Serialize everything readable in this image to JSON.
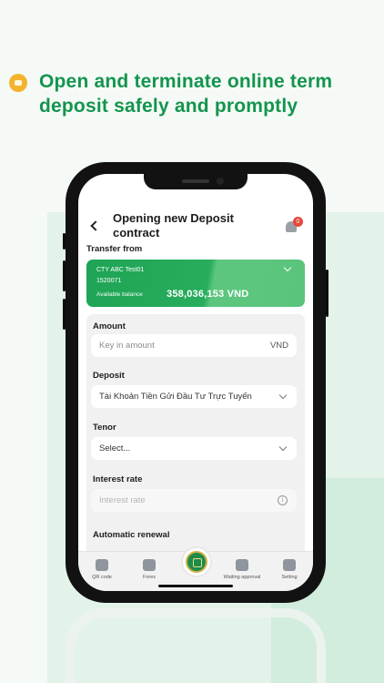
{
  "headline": "Open and terminate online term deposit safely and promptly",
  "screen": {
    "title": "Opening new Deposit contract",
    "notification_count": "0",
    "transfer_from_label": "Transfer from",
    "account": {
      "name": "CTY ABC Test01",
      "number": "1520071",
      "balance_label": "Available balance",
      "balance": "358,036,153 VND"
    },
    "form": {
      "amount_label": "Amount",
      "amount_placeholder": "Key in amount",
      "amount_unit": "VND",
      "deposit_label": "Deposit",
      "deposit_value": "Tài Khoản Tiền Gửi Đầu Tư Trực Tuyến",
      "tenor_label": "Tenor",
      "tenor_value": "Select...",
      "interest_label": "Interest rate",
      "interest_placeholder": "Interest rate",
      "renewal_label": "Automatic renewal"
    },
    "tabs": [
      {
        "label": "QR code",
        "icon": "qr-icon"
      },
      {
        "label": "Forex",
        "icon": "forex-icon"
      },
      {
        "label": "Waiting approval",
        "icon": "clipboard-icon"
      },
      {
        "label": "Setting",
        "icon": "gear-icon"
      }
    ]
  },
  "colors": {
    "brand_green": "#13954d",
    "card_green": "#1fa455",
    "badge_red": "#e8453c",
    "coin_yellow": "#f3b32c"
  }
}
